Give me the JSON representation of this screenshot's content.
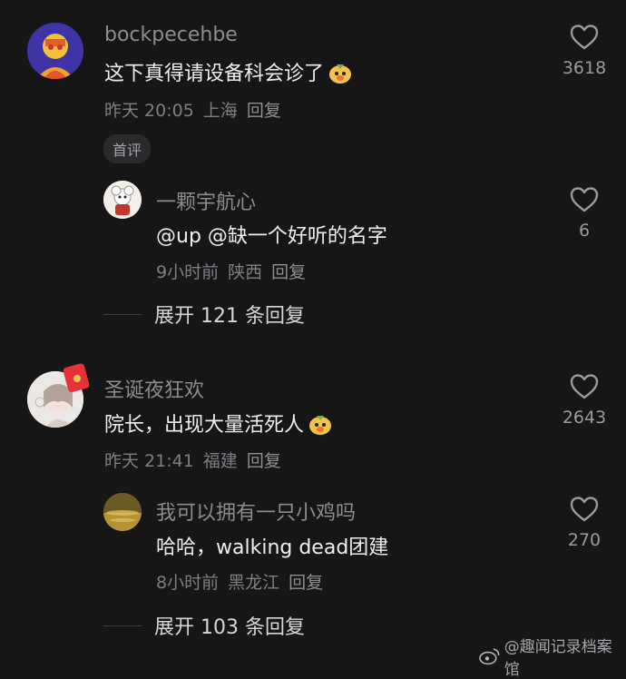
{
  "comments": [
    {
      "username": "bockpecehbe",
      "text": "这下真得请设备科会诊了",
      "time": "昨天 20:05",
      "location": "上海",
      "reply": "回复",
      "likes": "3618",
      "badge": "首评",
      "replies": [
        {
          "username": "一颗宇航心",
          "text": "@up @缺一个好听的名字",
          "time": "9小时前",
          "location": "陕西",
          "reply": "回复",
          "likes": "6"
        }
      ],
      "expand_label": "展开 121 条回复"
    },
    {
      "username": "圣诞夜狂欢",
      "text": "院长，出现大量活死人",
      "time": "昨天 21:41",
      "location": "福建",
      "reply": "回复",
      "likes": "2643",
      "replies": [
        {
          "username": "我可以拥有一只小鸡吗",
          "text": "哈哈，walking dead团建",
          "time": "8小时前",
          "location": "黑龙江",
          "reply": "回复",
          "likes": "270"
        }
      ],
      "expand_label": "展开 103 条回复"
    }
  ],
  "watermark": "@趣闻记录档案馆",
  "colors": {
    "background": "#161617",
    "username": "#8c8c91",
    "text": "#efefef",
    "meta": "#7e7e84"
  }
}
